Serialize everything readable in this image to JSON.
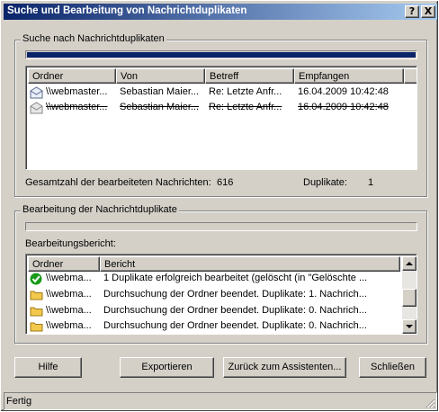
{
  "window": {
    "title": "Suche und Bearbeitung von Nachrichtduplikaten",
    "help_glyph": "?",
    "close_glyph": "X"
  },
  "search": {
    "group_label": "Suche nach Nachrichtduplikaten",
    "progress": 1.0,
    "columns": [
      "Ordner",
      "Von",
      "Betreff",
      "Empfangen"
    ],
    "rows": [
      {
        "icon": "envelope-icon",
        "ordner": "\\\\webmaster...",
        "von": "Sebastian Maier...",
        "betreff": "Re: Letzte Anfr...",
        "empfangen": "16.04.2009 10:42:48",
        "struck": false
      },
      {
        "icon": "envelope-icon",
        "ordner": "\\\\webmaster...",
        "von": "Sebastian Maier...",
        "betreff": "Re: Letzte Anfr...",
        "empfangen": "16.04.2009 10:42:48",
        "struck": true
      }
    ],
    "total_label": "Gesamtzahl der bearbeiteten Nachrichten:",
    "total_value": "616",
    "duplicates_label": "Duplikate:",
    "duplicates_value": "1"
  },
  "processing": {
    "group_label": "Bearbeitung der Nachrichtduplikate",
    "progress": 0.0,
    "report_label": "Bearbeitungsbericht:",
    "columns": [
      "Ordner",
      "Bericht"
    ],
    "rows": [
      {
        "icon": "checkmark-icon",
        "ordner": "\\\\webma...",
        "bericht": "1 Duplikate erfolgreich bearbeitet (gelöscht (in \"Gelöschte ..."
      },
      {
        "icon": "folder-icon",
        "ordner": "\\\\webma...",
        "bericht": "Durchsuchung der Ordner beendet. Duplikate: 1. Nachrich..."
      },
      {
        "icon": "folder-icon",
        "ordner": "\\\\webma...",
        "bericht": "Durchsuchung der Ordner beendet. Duplikate: 0. Nachrich..."
      },
      {
        "icon": "folder-icon",
        "ordner": "\\\\webma...",
        "bericht": "Durchsuchung der Ordner beendet. Duplikate: 0. Nachrich..."
      }
    ]
  },
  "buttons": {
    "help": "Hilfe",
    "export": "Exportieren",
    "back": "Zurück zum Assistenten...",
    "close": "Schließen"
  },
  "status": {
    "text": "Fertig"
  },
  "colors": {
    "title_start": "#0a246a",
    "title_end": "#a6caf0",
    "progress": "#0a246a",
    "check": "#1a9b1a",
    "folder": "#f2c94c"
  }
}
